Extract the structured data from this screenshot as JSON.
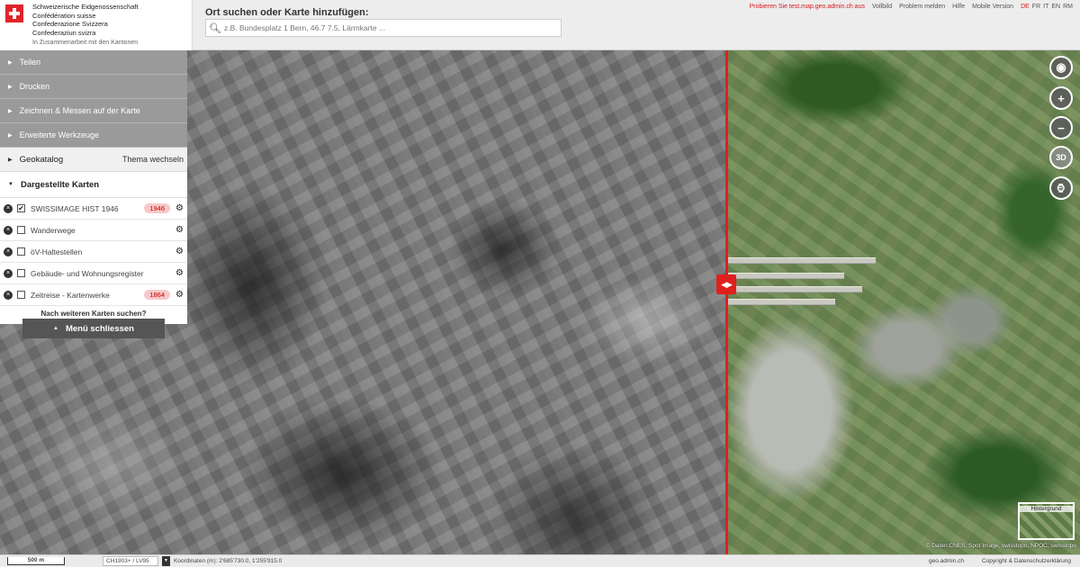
{
  "header": {
    "logo": {
      "lines": [
        "Schweizerische Eidgenossenschaft",
        "Confédération suisse",
        "Confederazione Svizzera",
        "Confederaziun svizra"
      ],
      "subline": "In Zusammenarbeit mit den Kantonen"
    },
    "search_label": "Ort suchen oder Karte hinzufügen:",
    "search_placeholder": "z.B. Bundesplatz 1 Bern, 46.7 7.5, Lärmkarte ...",
    "links": {
      "test": "Probieren Sie test.map.geo.admin.ch aus",
      "fullscreen": "Vollbild",
      "report": "Problem melden",
      "help": "Hilfe",
      "mobile": "Mobile Version"
    },
    "languages": [
      "DE",
      "FR",
      "IT",
      "EN",
      "RM"
    ],
    "active_language": "DE"
  },
  "sidebar": {
    "menu": [
      "Teilen",
      "Drucken",
      "Zeichnen & Messen auf der Karte",
      "Erweiterte Werkzeuge"
    ],
    "geokatalog": {
      "label": "Geokatalog",
      "action": "Thema wechseln"
    },
    "displayed_maps": {
      "label": "Dargestellte Karten",
      "layers": [
        {
          "name": "SWISSIMAGE HIST 1946",
          "checked": true,
          "year": "1946"
        },
        {
          "name": "Wanderwege",
          "checked": false,
          "year": ""
        },
        {
          "name": "öV-Haltestellen",
          "checked": false,
          "year": ""
        },
        {
          "name": "Gebäude- und Wohnungsregister",
          "checked": false,
          "year": ""
        },
        {
          "name": "Zeitreise - Kartenwerke",
          "checked": false,
          "year": "1864"
        }
      ],
      "more_maps": "Nach weiteren Karten suchen?"
    },
    "close_menu": "Menü schliessen"
  },
  "map": {
    "controls": {
      "threed": "3D"
    },
    "background_selector": "Hintergrund",
    "attribution": "© Daten:CNES, Spot Image, swisstopo, NPOC, swisstopo"
  },
  "footer": {
    "scale": "500 m",
    "crs": "CH1903+ / LV95",
    "coordinates": "Koordinaten (m): 2'685'730.0, 1'255'915.0",
    "site": "geo.admin.ch",
    "copyright": "Copyright & Datenschutzerklärung"
  },
  "colors": {
    "accent_red": "#e01f1f",
    "menu_gray": "#9a9a9a"
  },
  "icons": [
    "swiss-flag-icon",
    "search-icon",
    "remove-layer-icon",
    "checkbox-icon",
    "gear-icon",
    "geolocation-icon",
    "zoom-in-icon",
    "zoom-out-icon",
    "3d-icon",
    "time-icon",
    "swipe-icon"
  ]
}
